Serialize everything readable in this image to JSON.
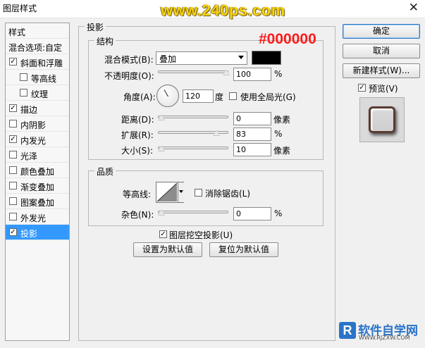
{
  "window": {
    "title": "图层样式",
    "close_icon": "✕"
  },
  "watermark": "www.240ps.com",
  "annotation": "#000000",
  "sidebar": {
    "header": "样式",
    "blend_options": "混合选项:自定",
    "items": [
      {
        "label": "斜面和浮雕",
        "checked": true
      },
      {
        "label": "等高线",
        "checked": false
      },
      {
        "label": "纹理",
        "checked": false
      },
      {
        "label": "描边",
        "checked": true
      },
      {
        "label": "内阴影",
        "checked": false
      },
      {
        "label": "内发光",
        "checked": true
      },
      {
        "label": "光泽",
        "checked": false
      },
      {
        "label": "颜色叠加",
        "checked": false
      },
      {
        "label": "渐变叠加",
        "checked": false
      },
      {
        "label": "图案叠加",
        "checked": false
      },
      {
        "label": "外发光",
        "checked": false
      },
      {
        "label": "投影",
        "checked": true,
        "selected": true
      }
    ]
  },
  "shadow": {
    "title": "投影",
    "structure": {
      "title": "结构",
      "blend_mode_label": "混合模式(B):",
      "blend_mode_value": "叠加",
      "color": "#000000",
      "opacity_label": "不透明度(O):",
      "opacity_value": "100",
      "opacity_unit": "%",
      "opacity_fraction": 1.0,
      "angle_label": "角度(A):",
      "angle_value": "120",
      "angle_unit": "度",
      "global_light_label": "使用全局光(G)",
      "global_light_checked": false,
      "distance_label": "距离(D):",
      "distance_value": "0",
      "distance_unit": "像素",
      "distance_fraction": 0.0,
      "spread_label": "扩展(R):",
      "spread_value": "83",
      "spread_unit": "%",
      "spread_fraction": 0.83,
      "size_label": "大小(S):",
      "size_value": "10",
      "size_unit": "像素",
      "size_fraction": 0.05
    },
    "quality": {
      "title": "品质",
      "contour_label": "等高线:",
      "antialias_label": "消除锯齿(L)",
      "antialias_checked": false,
      "noise_label": "杂色(N):",
      "noise_value": "0",
      "noise_unit": "%",
      "noise_fraction": 0.0
    },
    "knockout_label": "图层挖空投影(U)",
    "knockout_checked": true,
    "set_default_label": "设置为默认值",
    "reset_default_label": "复位为默认值"
  },
  "buttons": {
    "ok": "确定",
    "cancel": "取消",
    "new_style": "新建样式(W)...",
    "preview_label": "预览(V)",
    "preview_checked": true
  },
  "logo": {
    "mark": "R",
    "name": "软件自学网",
    "url": "WWW.RJZXW.COM"
  }
}
